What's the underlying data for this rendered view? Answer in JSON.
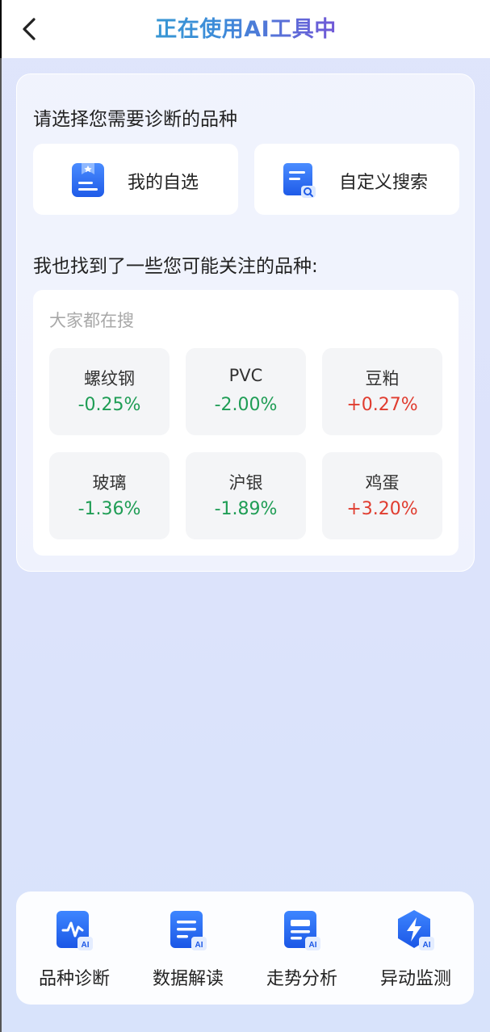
{
  "header": {
    "title": "正在使用AI工具中"
  },
  "card": {
    "choose_title": "请选择您需要诊断的品种",
    "choices": [
      {
        "label": "我的自选",
        "icon": "bookmark-doc-icon"
      },
      {
        "label": "自定义搜索",
        "icon": "search-doc-icon"
      }
    ],
    "found_title": "我也找到了一些您可能关注的品种:",
    "hot_title": "大家都在搜",
    "items": [
      {
        "name": "螺纹钢",
        "change": "-0.25%",
        "trend": "down"
      },
      {
        "name": "PVC",
        "change": "-2.00%",
        "trend": "down"
      },
      {
        "name": "豆粕",
        "change": "+0.27%",
        "trend": "up"
      },
      {
        "name": "玻璃",
        "change": "-1.36%",
        "trend": "down"
      },
      {
        "name": "沪银",
        "change": "-1.89%",
        "trend": "down"
      },
      {
        "name": "鸡蛋",
        "change": "+3.20%",
        "trend": "up"
      }
    ]
  },
  "tools": [
    {
      "label": "品种诊断",
      "icon": "pulse-ai-icon"
    },
    {
      "label": "数据解读",
      "icon": "document-ai-icon"
    },
    {
      "label": "走势分析",
      "icon": "card-ai-icon"
    },
    {
      "label": "异动监测",
      "icon": "lightning-ai-icon"
    }
  ],
  "colors": {
    "up": "#e03c2f",
    "down": "#1f9d55",
    "accent": "#1f6bf0"
  }
}
